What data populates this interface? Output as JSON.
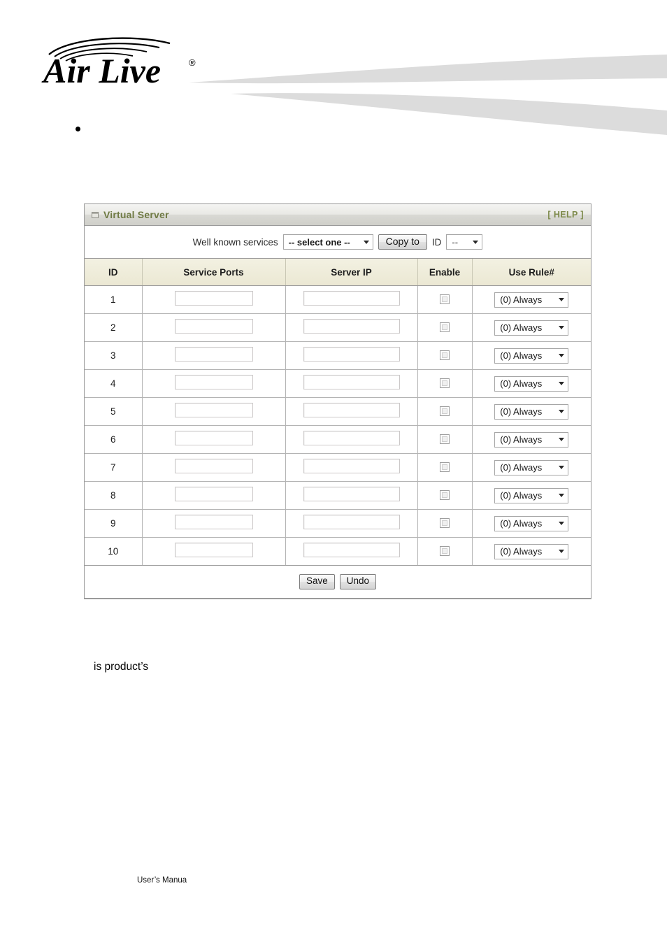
{
  "brand": {
    "logo_text": "Air Live",
    "logo_trademark": "®",
    "logo_icon": "wireless-arcs-icon"
  },
  "bullet": {
    "marker": "•",
    "text": ""
  },
  "panel": {
    "icon": "window-square-icon",
    "title": "Virtual Server",
    "help_label": "[ HELP ]"
  },
  "well_known_services": {
    "label": "Well known services",
    "service_select": {
      "value": "-- select one --",
      "caret": "chevron-down-icon"
    },
    "copy_to_label": "Copy to",
    "id_label": "ID",
    "id_select": {
      "value": "--",
      "caret": "chevron-down-icon"
    }
  },
  "table": {
    "columns": [
      "ID",
      "Service Ports",
      "Server IP",
      "Enable",
      "Use Rule#"
    ],
    "rows": [
      {
        "id": "1",
        "service_ports": "",
        "server_ip": "",
        "enable": false,
        "rule": "(0) Always"
      },
      {
        "id": "2",
        "service_ports": "",
        "server_ip": "",
        "enable": false,
        "rule": "(0) Always"
      },
      {
        "id": "3",
        "service_ports": "",
        "server_ip": "",
        "enable": false,
        "rule": "(0) Always"
      },
      {
        "id": "4",
        "service_ports": "",
        "server_ip": "",
        "enable": false,
        "rule": "(0) Always"
      },
      {
        "id": "5",
        "service_ports": "",
        "server_ip": "",
        "enable": false,
        "rule": "(0) Always"
      },
      {
        "id": "6",
        "service_ports": "",
        "server_ip": "",
        "enable": false,
        "rule": "(0) Always"
      },
      {
        "id": "7",
        "service_ports": "",
        "server_ip": "",
        "enable": false,
        "rule": "(0) Always"
      },
      {
        "id": "8",
        "service_ports": "",
        "server_ip": "",
        "enable": false,
        "rule": "(0) Always"
      },
      {
        "id": "9",
        "service_ports": "",
        "server_ip": "",
        "enable": false,
        "rule": "(0) Always"
      },
      {
        "id": "10",
        "service_ports": "",
        "server_ip": "",
        "enable": false,
        "rule": "(0) Always"
      }
    ]
  },
  "footer_actions": {
    "save_label": "Save",
    "undo_label": "Undo"
  },
  "body_text": {
    "fragment": "is product’s"
  },
  "page_footer": {
    "text": "User’s Manua"
  },
  "colors": {
    "panel_border": "#9a9a9a",
    "title_text": "#6f7a43",
    "help_text": "#7d8a4a",
    "table_header_bg": "#ebe8d3",
    "swoosh": "#dcdcdc"
  }
}
